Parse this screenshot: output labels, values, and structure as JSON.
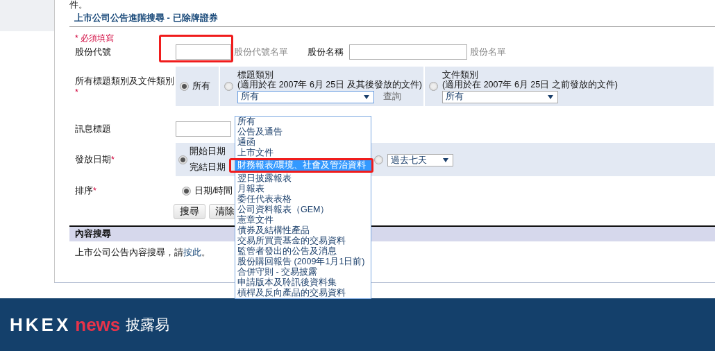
{
  "intro_tail": "件。",
  "title": "上市公司公告進階搜尋 - 已除牌證券",
  "required_note": "* 必須填寫",
  "stock_code": {
    "label": "股份代號",
    "link": "股份代號名單",
    "highlighted": true
  },
  "stock_name": {
    "label": "股份名稱",
    "link": "股份名單"
  },
  "category": {
    "label": "所有標題類別及文件類別",
    "required_mark": "*",
    "options": [
      {
        "kind": "all",
        "label": "所有",
        "selected": true
      },
      {
        "kind": "headline",
        "title": "標題類別",
        "note": "(適用於在 2007年 6月 25日 及其後發放的文件)",
        "select_value": "所有",
        "lookup": "查詢",
        "selected": false,
        "open": true
      },
      {
        "kind": "document",
        "title": "文件類別",
        "note": "(適用於在 2007年 6月 25日 之前發放的文件)",
        "select_value": "所有",
        "selected": false
      }
    ]
  },
  "headline_field": {
    "label": "訊息標題"
  },
  "date": {
    "label": "發放日期",
    "required_mark": "*",
    "options": [
      {
        "kind": "range",
        "selected": true,
        "start_label": "開始日期",
        "end_label": "完結日期"
      },
      {
        "kind": "preset",
        "selected": false,
        "value": "過去七天"
      }
    ]
  },
  "sort": {
    "label": "排序",
    "required_mark": "*",
    "options": [
      {
        "label": "日期/時間",
        "selected": true
      }
    ]
  },
  "buttons": [
    "搜尋",
    "清除"
  ],
  "content_search": {
    "heading": "內容搜尋",
    "text": "上市公司公告內容搜尋，請",
    "link": "按此",
    "tail": "。"
  },
  "dropdown": {
    "items": [
      {
        "label": "所有",
        "selected": false,
        "highlighted": false
      },
      {
        "label": "公告及通告",
        "selected": false,
        "highlighted": false
      },
      {
        "label": "通函",
        "selected": false,
        "highlighted": false
      },
      {
        "label": "上市文件",
        "selected": false,
        "highlighted": false
      },
      {
        "label": "財務報表/環境、社會及管治資料",
        "selected": true,
        "highlighted": true
      },
      {
        "label": "翌日披露報表",
        "selected": false,
        "highlighted": false
      },
      {
        "label": "月報表",
        "selected": false,
        "highlighted": false
      },
      {
        "label": "委任代表表格",
        "selected": false,
        "highlighted": false
      },
      {
        "label": "公司資料報表（GEM）",
        "selected": false,
        "highlighted": false
      },
      {
        "label": "憲章文件",
        "selected": false,
        "highlighted": false
      },
      {
        "label": "債券及結構性產品",
        "selected": false,
        "highlighted": false
      },
      {
        "label": "交易所買賣基金的交易資料",
        "selected": false,
        "highlighted": false
      },
      {
        "label": "監管者發出的公告及消息",
        "selected": false,
        "highlighted": false
      },
      {
        "label": "股份購回報告 (2009年1月1日前)",
        "selected": false,
        "highlighted": false
      },
      {
        "label": "合併守則 - 交易披露",
        "selected": false,
        "highlighted": false
      },
      {
        "label": "申請版本及聆訊後資料集",
        "selected": false,
        "highlighted": false
      },
      {
        "label": "槓桿及反向產品的交易資料",
        "selected": false,
        "highlighted": false
      }
    ]
  },
  "footer": {
    "logo_letters": "HKEX",
    "logo_word": "news",
    "logo_chinese": "披露易"
  }
}
